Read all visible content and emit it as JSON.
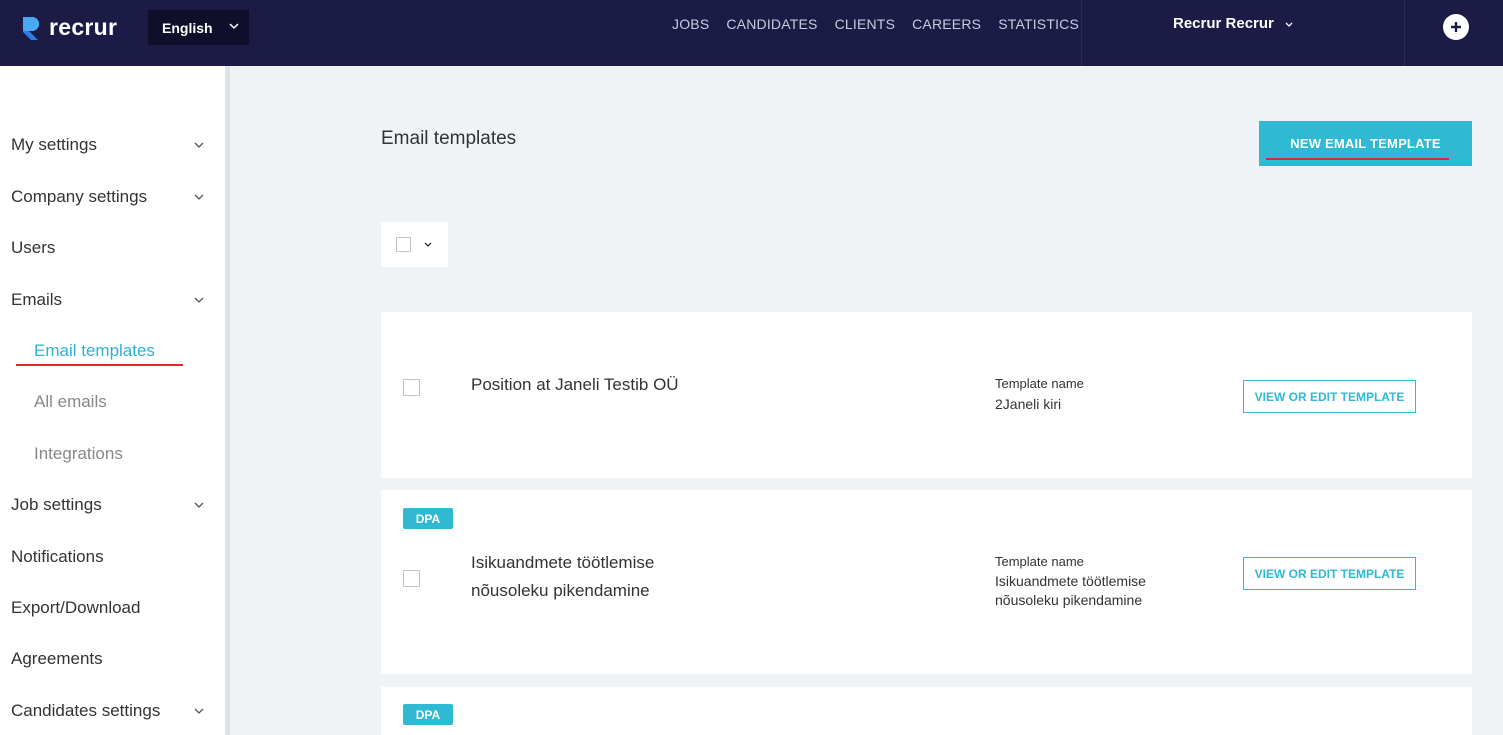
{
  "header": {
    "brand": "recrur",
    "language": "English",
    "nav": [
      "JOBS",
      "CANDIDATES",
      "CLIENTS",
      "CAREERS",
      "STATISTICS"
    ],
    "user_name": "Recrur Recrur",
    "icons": {
      "logo": "recrur-logo",
      "add": "plus-circle-icon",
      "dropdown": "chevron-down-icon"
    }
  },
  "sidebar": {
    "items": [
      {
        "label": "My settings",
        "expandable": true
      },
      {
        "label": "Company settings",
        "expandable": true
      },
      {
        "label": "Users",
        "expandable": false
      },
      {
        "label": "Emails",
        "expandable": true
      },
      {
        "label": "Job settings",
        "expandable": true
      },
      {
        "label": "Notifications",
        "expandable": false
      },
      {
        "label": "Export/Download",
        "expandable": false
      },
      {
        "label": "Agreements",
        "expandable": false
      },
      {
        "label": "Candidates settings",
        "expandable": true
      }
    ],
    "email_subitems": [
      {
        "label": "Email templates",
        "active": true
      },
      {
        "label": "All emails",
        "active": false
      },
      {
        "label": "Integrations",
        "active": false
      }
    ]
  },
  "main": {
    "title": "Email templates",
    "new_button": "NEW EMAIL TEMPLATE",
    "templates": [
      {
        "badge": "",
        "title": "Position at Janeli Testib OÜ",
        "name_label": "Template name",
        "name": "2Janeli kiri",
        "action": "VIEW OR EDIT TEMPLATE"
      },
      {
        "badge": "DPA",
        "title": "Isikuandmete töötlemise nõusoleku pikendamine",
        "name_label": "Template name",
        "name": "Isikuandmete töötlemise nõusoleku pikendamine",
        "action": "VIEW OR EDIT TEMPLATE"
      },
      {
        "badge": "DPA"
      }
    ]
  },
  "colors": {
    "topbar": "#1b1b46",
    "accent": "#2fb9d3",
    "annotation": "#e0272c"
  }
}
